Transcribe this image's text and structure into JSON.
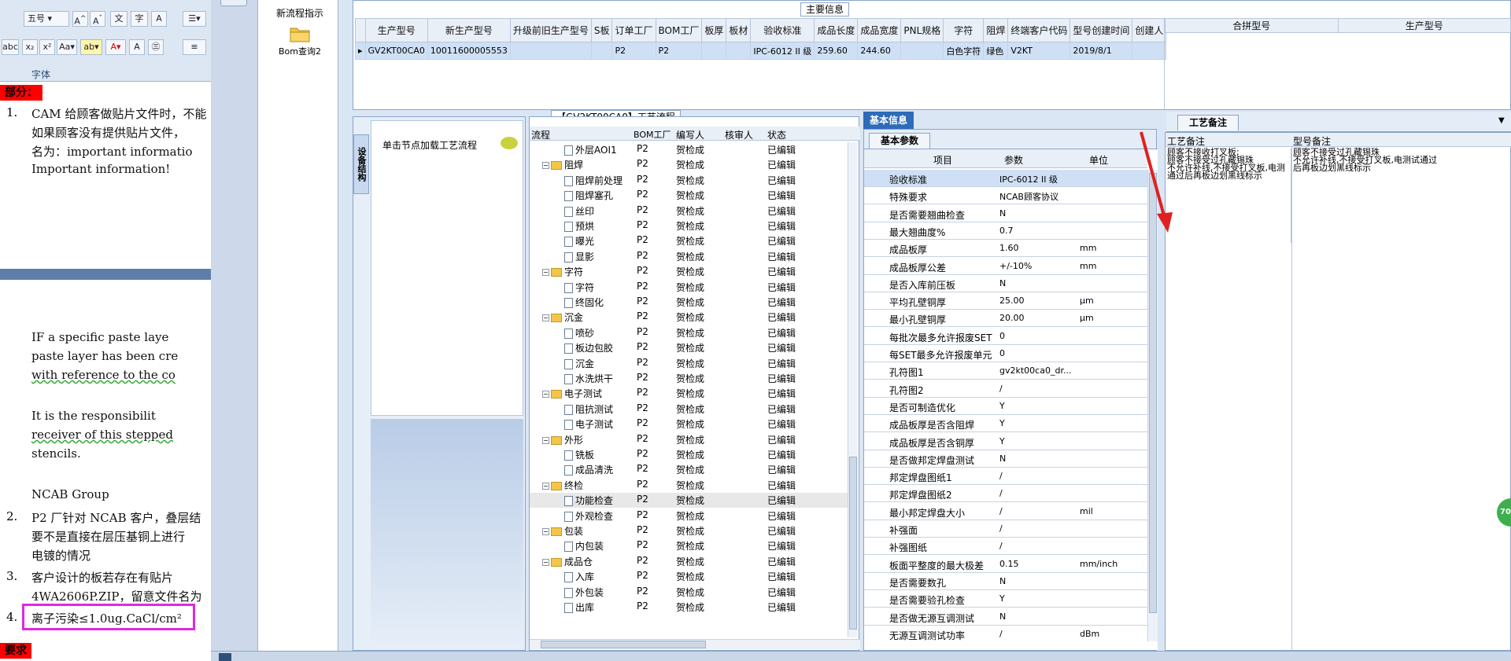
{
  "word": {
    "ribbon": {
      "font_size": "五号",
      "group_label": "字体",
      "buttons": [
        "A",
        "A",
        "文",
        "A"
      ],
      "row2": [
        "x₂",
        "x²",
        "Aa",
        "aby",
        "A",
        "A",
        "字"
      ]
    },
    "section_title": "部分：",
    "items": [
      {
        "num": "1.",
        "lines": [
          "CAM 给顾客做贴片文件时，不能",
          "如果顾客没有提供贴片文件，",
          "名为：important informatio",
          "Important information!"
        ]
      },
      {
        "num": "",
        "lines": [
          "IF a specific paste laye",
          "paste layer has been cre",
          "with reference to the co",
          "",
          "It is the responsibilit",
          "receiver of this stepped",
          "stencils.",
          "",
          "NCAB Group"
        ]
      },
      {
        "num": "2.",
        "lines": [
          "P2 厂针对 NCAB 客户，叠层结",
          "要不是直接在层压基铜上进行",
          "电镀的情况"
        ]
      },
      {
        "num": "3.",
        "lines": [
          "客户设计的板若存在有贴片",
          "4WA2606P.ZIP，留意文件名为"
        ]
      },
      {
        "num": "4.",
        "lines": [
          "离子污染≤1.0ug.CaCl/cm²"
        ]
      }
    ],
    "bottom_label": "要求"
  },
  "app": {
    "buttons": [
      {
        "label": "新流程指示",
        "icon": "pen-icon"
      },
      {
        "label": "Bom查询2",
        "icon": "folder-icon"
      }
    ],
    "main_info": {
      "title": "主要信息",
      "columns": [
        "生产型号",
        "新生产型号",
        "升级前旧生产型号",
        "S板",
        "订单工厂",
        "BOM工厂",
        "板厚",
        "板材",
        "验收标准",
        "成品长度",
        "成品宽度",
        "PNL规格",
        "字符",
        "阻焊",
        "终端客户代码",
        "型号创建时间",
        "创建人"
      ],
      "row": [
        "GV2KT00CA0",
        "10011600005553",
        "",
        "",
        "P2",
        "P2",
        "",
        "",
        "IPC-6012 II 级",
        "259.60",
        "244.60",
        "",
        "白色字符",
        "绿色",
        "V2KT",
        "2019/8/1",
        ""
      ],
      "side_columns": [
        "合拼型号",
        "生产型号"
      ]
    },
    "left_nav": {
      "vertical_tab": "设备结构",
      "hint": "单击节点加载工艺流程"
    },
    "process": {
      "title": "【GV2KT00CA0】工艺流程",
      "columns": [
        "流程",
        "BOM工厂",
        "编写人",
        "核审人",
        "状态"
      ],
      "rows": [
        {
          "indent": 2,
          "kind": "page",
          "name": "外层AOI1",
          "factory": "P2",
          "author": "贺检成",
          "status": "已编辑"
        },
        {
          "indent": 1,
          "kind": "folder",
          "name": "阻焊",
          "factory": "P2",
          "author": "贺检成",
          "status": "已编辑"
        },
        {
          "indent": 2,
          "kind": "page",
          "name": "阻焊前处理",
          "factory": "P2",
          "author": "贺检成",
          "status": "已编辑"
        },
        {
          "indent": 2,
          "kind": "page",
          "name": "阻焊塞孔",
          "factory": "P2",
          "author": "贺检成",
          "status": "已编辑"
        },
        {
          "indent": 2,
          "kind": "page",
          "name": "丝印",
          "factory": "P2",
          "author": "贺检成",
          "status": "已编辑"
        },
        {
          "indent": 2,
          "kind": "page",
          "name": "预烘",
          "factory": "P2",
          "author": "贺检成",
          "status": "已编辑"
        },
        {
          "indent": 2,
          "kind": "page",
          "name": "曝光",
          "factory": "P2",
          "author": "贺检成",
          "status": "已编辑"
        },
        {
          "indent": 2,
          "kind": "page",
          "name": "显影",
          "factory": "P2",
          "author": "贺检成",
          "status": "已编辑"
        },
        {
          "indent": 1,
          "kind": "folder",
          "name": "字符",
          "factory": "P2",
          "author": "贺检成",
          "status": "已编辑"
        },
        {
          "indent": 2,
          "kind": "page",
          "name": "字符",
          "factory": "P2",
          "author": "贺检成",
          "status": "已编辑"
        },
        {
          "indent": 2,
          "kind": "page",
          "name": "终固化",
          "factory": "P2",
          "author": "贺检成",
          "status": "已编辑"
        },
        {
          "indent": 1,
          "kind": "folder",
          "name": "沉金",
          "factory": "P2",
          "author": "贺检成",
          "status": "已编辑"
        },
        {
          "indent": 2,
          "kind": "page",
          "name": "喷砂",
          "factory": "P2",
          "author": "贺检成",
          "status": "已编辑"
        },
        {
          "indent": 2,
          "kind": "page",
          "name": "板边包胶",
          "factory": "P2",
          "author": "贺检成",
          "status": "已编辑"
        },
        {
          "indent": 2,
          "kind": "page",
          "name": "沉金",
          "factory": "P2",
          "author": "贺检成",
          "status": "已编辑"
        },
        {
          "indent": 2,
          "kind": "page",
          "name": "水洗烘干",
          "factory": "P2",
          "author": "贺检成",
          "status": "已编辑"
        },
        {
          "indent": 1,
          "kind": "folder",
          "name": "电子测试",
          "factory": "P2",
          "author": "贺检成",
          "status": "已编辑"
        },
        {
          "indent": 2,
          "kind": "page",
          "name": "阻抗测试",
          "factory": "P2",
          "author": "贺检成",
          "status": "已编辑"
        },
        {
          "indent": 2,
          "kind": "page",
          "name": "电子测试",
          "factory": "P2",
          "author": "贺检成",
          "status": "已编辑"
        },
        {
          "indent": 1,
          "kind": "folder",
          "name": "外形",
          "factory": "P2",
          "author": "贺检成",
          "status": "已编辑"
        },
        {
          "indent": 2,
          "kind": "page",
          "name": "铣板",
          "factory": "P2",
          "author": "贺检成",
          "status": "已编辑"
        },
        {
          "indent": 2,
          "kind": "page",
          "name": "成品清洗",
          "factory": "P2",
          "author": "贺检成",
          "status": "已编辑"
        },
        {
          "indent": 1,
          "kind": "folder",
          "name": "终检",
          "factory": "P2",
          "author": "贺检成",
          "status": "已编辑"
        },
        {
          "indent": 2,
          "kind": "page",
          "name": "功能检查",
          "factory": "P2",
          "author": "贺检成",
          "status": "已编辑",
          "selected": true
        },
        {
          "indent": 2,
          "kind": "page",
          "name": "外观检查",
          "factory": "P2",
          "author": "贺检成",
          "status": "已编辑"
        },
        {
          "indent": 1,
          "kind": "folder",
          "name": "包装",
          "factory": "P2",
          "author": "贺检成",
          "status": "已编辑"
        },
        {
          "indent": 2,
          "kind": "page",
          "name": "内包装",
          "factory": "P2",
          "author": "贺检成",
          "status": "已编辑"
        },
        {
          "indent": 1,
          "kind": "folder",
          "name": "成品仓",
          "factory": "P2",
          "author": "贺检成",
          "status": "已编辑"
        },
        {
          "indent": 2,
          "kind": "page",
          "name": "入库",
          "factory": "P2",
          "author": "贺检成",
          "status": "已编辑"
        },
        {
          "indent": 2,
          "kind": "page",
          "name": "外包装",
          "factory": "P2",
          "author": "贺检成",
          "status": "已编辑"
        },
        {
          "indent": 2,
          "kind": "page",
          "name": "出库",
          "factory": "P2",
          "author": "贺检成",
          "status": "已编辑"
        }
      ]
    },
    "basic_info": {
      "header": "基本信息",
      "tab": "基本参数",
      "columns": [
        "项目",
        "参数",
        "单位"
      ],
      "rows": [
        {
          "item": "验收标准",
          "value": "IPC-6012 II 级",
          "unit": ""
        },
        {
          "item": "特殊要求",
          "value": "NCAB顾客协议",
          "unit": ""
        },
        {
          "item": "是否需要翘曲检查",
          "value": "N",
          "unit": ""
        },
        {
          "item": "最大翘曲度%",
          "value": "0.7",
          "unit": ""
        },
        {
          "item": "成品板厚",
          "value": "1.60",
          "unit": "mm"
        },
        {
          "item": "成品板厚公差",
          "value": "+/-10%",
          "unit": "mm"
        },
        {
          "item": "是否入库前压板",
          "value": "N",
          "unit": ""
        },
        {
          "item": "平均孔壁铜厚",
          "value": "25.00",
          "unit": "μm"
        },
        {
          "item": "最小孔壁铜厚",
          "value": "20.00",
          "unit": "μm"
        },
        {
          "item": "每批次最多允许报废SET",
          "value": "0",
          "unit": ""
        },
        {
          "item": "每SET最多允许报废单元",
          "value": "0",
          "unit": ""
        },
        {
          "item": "孔符图1",
          "value": "gv2kt00ca0_dr...",
          "unit": ""
        },
        {
          "item": "孔符图2",
          "value": "/",
          "unit": ""
        },
        {
          "item": "是否可制造优化",
          "value": "Y",
          "unit": ""
        },
        {
          "item": "成品板厚是否含阻焊",
          "value": "Y",
          "unit": ""
        },
        {
          "item": "成品板厚是否含铜厚",
          "value": "Y",
          "unit": ""
        },
        {
          "item": "是否做邦定焊盘测试",
          "value": "N",
          "unit": ""
        },
        {
          "item": "邦定焊盘图纸1",
          "value": "/",
          "unit": ""
        },
        {
          "item": "邦定焊盘图纸2",
          "value": "/",
          "unit": ""
        },
        {
          "item": "最小邦定焊盘大小",
          "value": "/",
          "unit": "mil"
        },
        {
          "item": "补强面",
          "value": "/",
          "unit": ""
        },
        {
          "item": "补强图纸",
          "value": "/",
          "unit": ""
        },
        {
          "item": "板面平整度的最大极差",
          "value": "0.15",
          "unit": "mm/inch"
        },
        {
          "item": "是否需要数孔",
          "value": "N",
          "unit": ""
        },
        {
          "item": "是否需要验孔检查",
          "value": "Y",
          "unit": ""
        },
        {
          "item": "是否做无源互调测试",
          "value": "N",
          "unit": ""
        },
        {
          "item": "无源互调测试功率",
          "value": "/",
          "unit": "dBm"
        }
      ]
    },
    "remarks": {
      "tab": "工艺备注",
      "columns": [
        "工艺备注",
        "型号备注"
      ],
      "process_note": [
        "顾客不接收打叉板;",
        "顾客不接受过孔藏锡珠",
        "不允许补线,不接受打叉板,电测",
        "通过后再板边划黑线标示"
      ],
      "model_note": [
        "顾客不接受过孔藏锡珠",
        "不允许补线,不接受打叉板,电测试通过",
        "后再板边划黑线标示"
      ]
    },
    "badge": "70",
    "colors": {
      "accent": "#2e6bb8",
      "arrow": "#e02020",
      "highlight_box": "#e028e0"
    }
  }
}
